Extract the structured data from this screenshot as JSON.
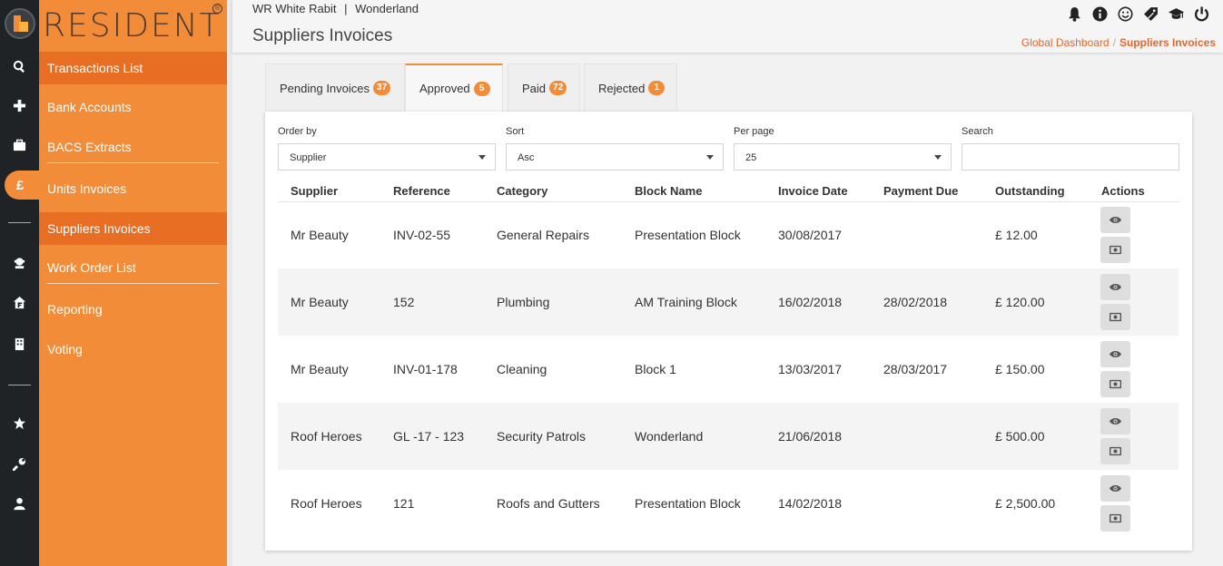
{
  "brand": {
    "name": "RESIDENT",
    "reg": "®"
  },
  "colors": {
    "accent": "#f28c38",
    "accent_dark": "#e86e24",
    "rail": "#1f2326",
    "link": "#e8652a"
  },
  "rail_icons": [
    "search-icon",
    "plus-icon",
    "briefcase-icon",
    "pound-icon",
    "agent-icon",
    "house-f-icon",
    "building-icon",
    "star-icon",
    "wrench-icon",
    "user-icon"
  ],
  "sidebar": {
    "items": [
      {
        "label": "Transactions List"
      },
      {
        "label": "Bank Accounts"
      },
      {
        "label": "BACS Extracts"
      },
      {
        "label": "Units Invoices"
      },
      {
        "label": "Suppliers Invoices"
      },
      {
        "label": "Work Order List"
      },
      {
        "label": "Reporting"
      },
      {
        "label": "Voting"
      }
    ]
  },
  "header": {
    "org_code": "WR White Rabit",
    "org_sep": "|",
    "org_name": "Wonderland",
    "title": "Suppliers Invoices",
    "icons": [
      "bell-icon",
      "info-icon",
      "smile-icon",
      "tag-icon",
      "graduation-icon",
      "power-icon"
    ]
  },
  "breadcrumb": {
    "home": "Global Dashboard",
    "sep": "/",
    "current": "Suppliers Invoices"
  },
  "tabs": [
    {
      "label": "Pending Invoices",
      "count": "37"
    },
    {
      "label": "Approved",
      "count": "5"
    },
    {
      "label": "Paid",
      "count": "72"
    },
    {
      "label": "Rejected",
      "count": "1"
    }
  ],
  "filters": {
    "order_by": {
      "label": "Order by",
      "value": "Supplier"
    },
    "sort": {
      "label": "Sort",
      "value": "Asc"
    },
    "per_page": {
      "label": "Per page",
      "value": "25"
    },
    "search": {
      "label": "Search",
      "value": ""
    }
  },
  "table": {
    "columns": [
      "Supplier",
      "Reference",
      "Category",
      "Block Name",
      "Invoice Date",
      "Payment Due",
      "Outstanding",
      "Actions"
    ],
    "rows": [
      [
        "Mr Beauty",
        "INV-02-55",
        "General Repairs",
        "Presentation Block",
        "30/08/2017",
        "",
        "£ 12.00"
      ],
      [
        "Mr Beauty",
        "152",
        "Plumbing",
        "AM Training Block",
        "16/02/2018",
        "28/02/2018",
        "£ 120.00"
      ],
      [
        "Mr Beauty",
        "INV-01-178",
        "Cleaning",
        "Block 1",
        "13/03/2017",
        "28/03/2017",
        "£ 150.00"
      ],
      [
        "Roof Heroes",
        "GL -17 - 123",
        "Security Patrols",
        "Wonderland",
        "21/06/2018",
        "",
        "£ 500.00"
      ],
      [
        "Roof Heroes",
        "121",
        "Roofs and Gutters",
        "Presentation Block",
        "14/02/2018",
        "",
        "£ 2,500.00"
      ]
    ],
    "action_icons": [
      "eye-icon",
      "money-icon"
    ]
  }
}
